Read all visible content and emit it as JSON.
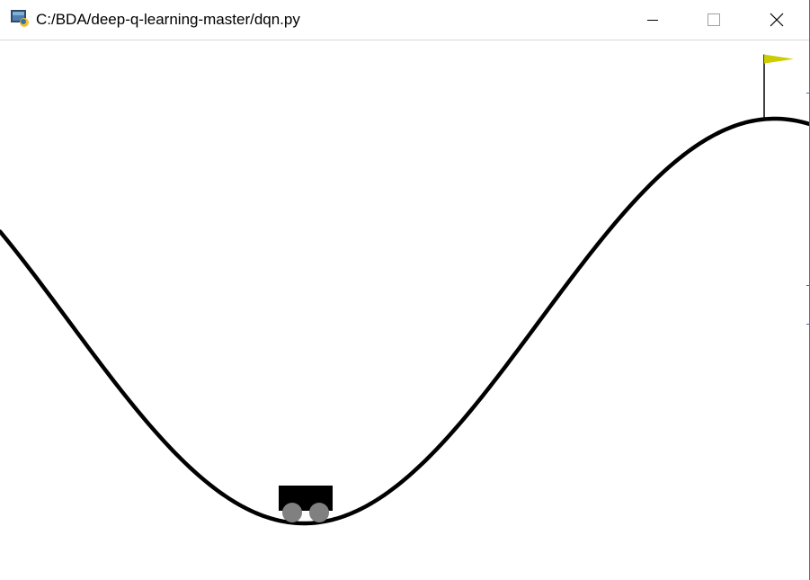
{
  "window": {
    "title": "C:/BDA/deep-q-learning-master/dqn.py",
    "icon": "python-app-icon",
    "controls": {
      "minimize_icon": "minimize-icon",
      "maximize_icon": "maximize-icon",
      "close_icon": "close-icon"
    }
  },
  "scene": {
    "environment": "mountain-car",
    "track_color": "#000000",
    "car_body_color": "#000000",
    "wheel_color": "#808080",
    "flag_color": "#cccc00",
    "flagpole_color": "#000000",
    "car_position": -0.52,
    "goal_position": 0.5,
    "x_range": [
      -1.2,
      0.6
    ]
  }
}
